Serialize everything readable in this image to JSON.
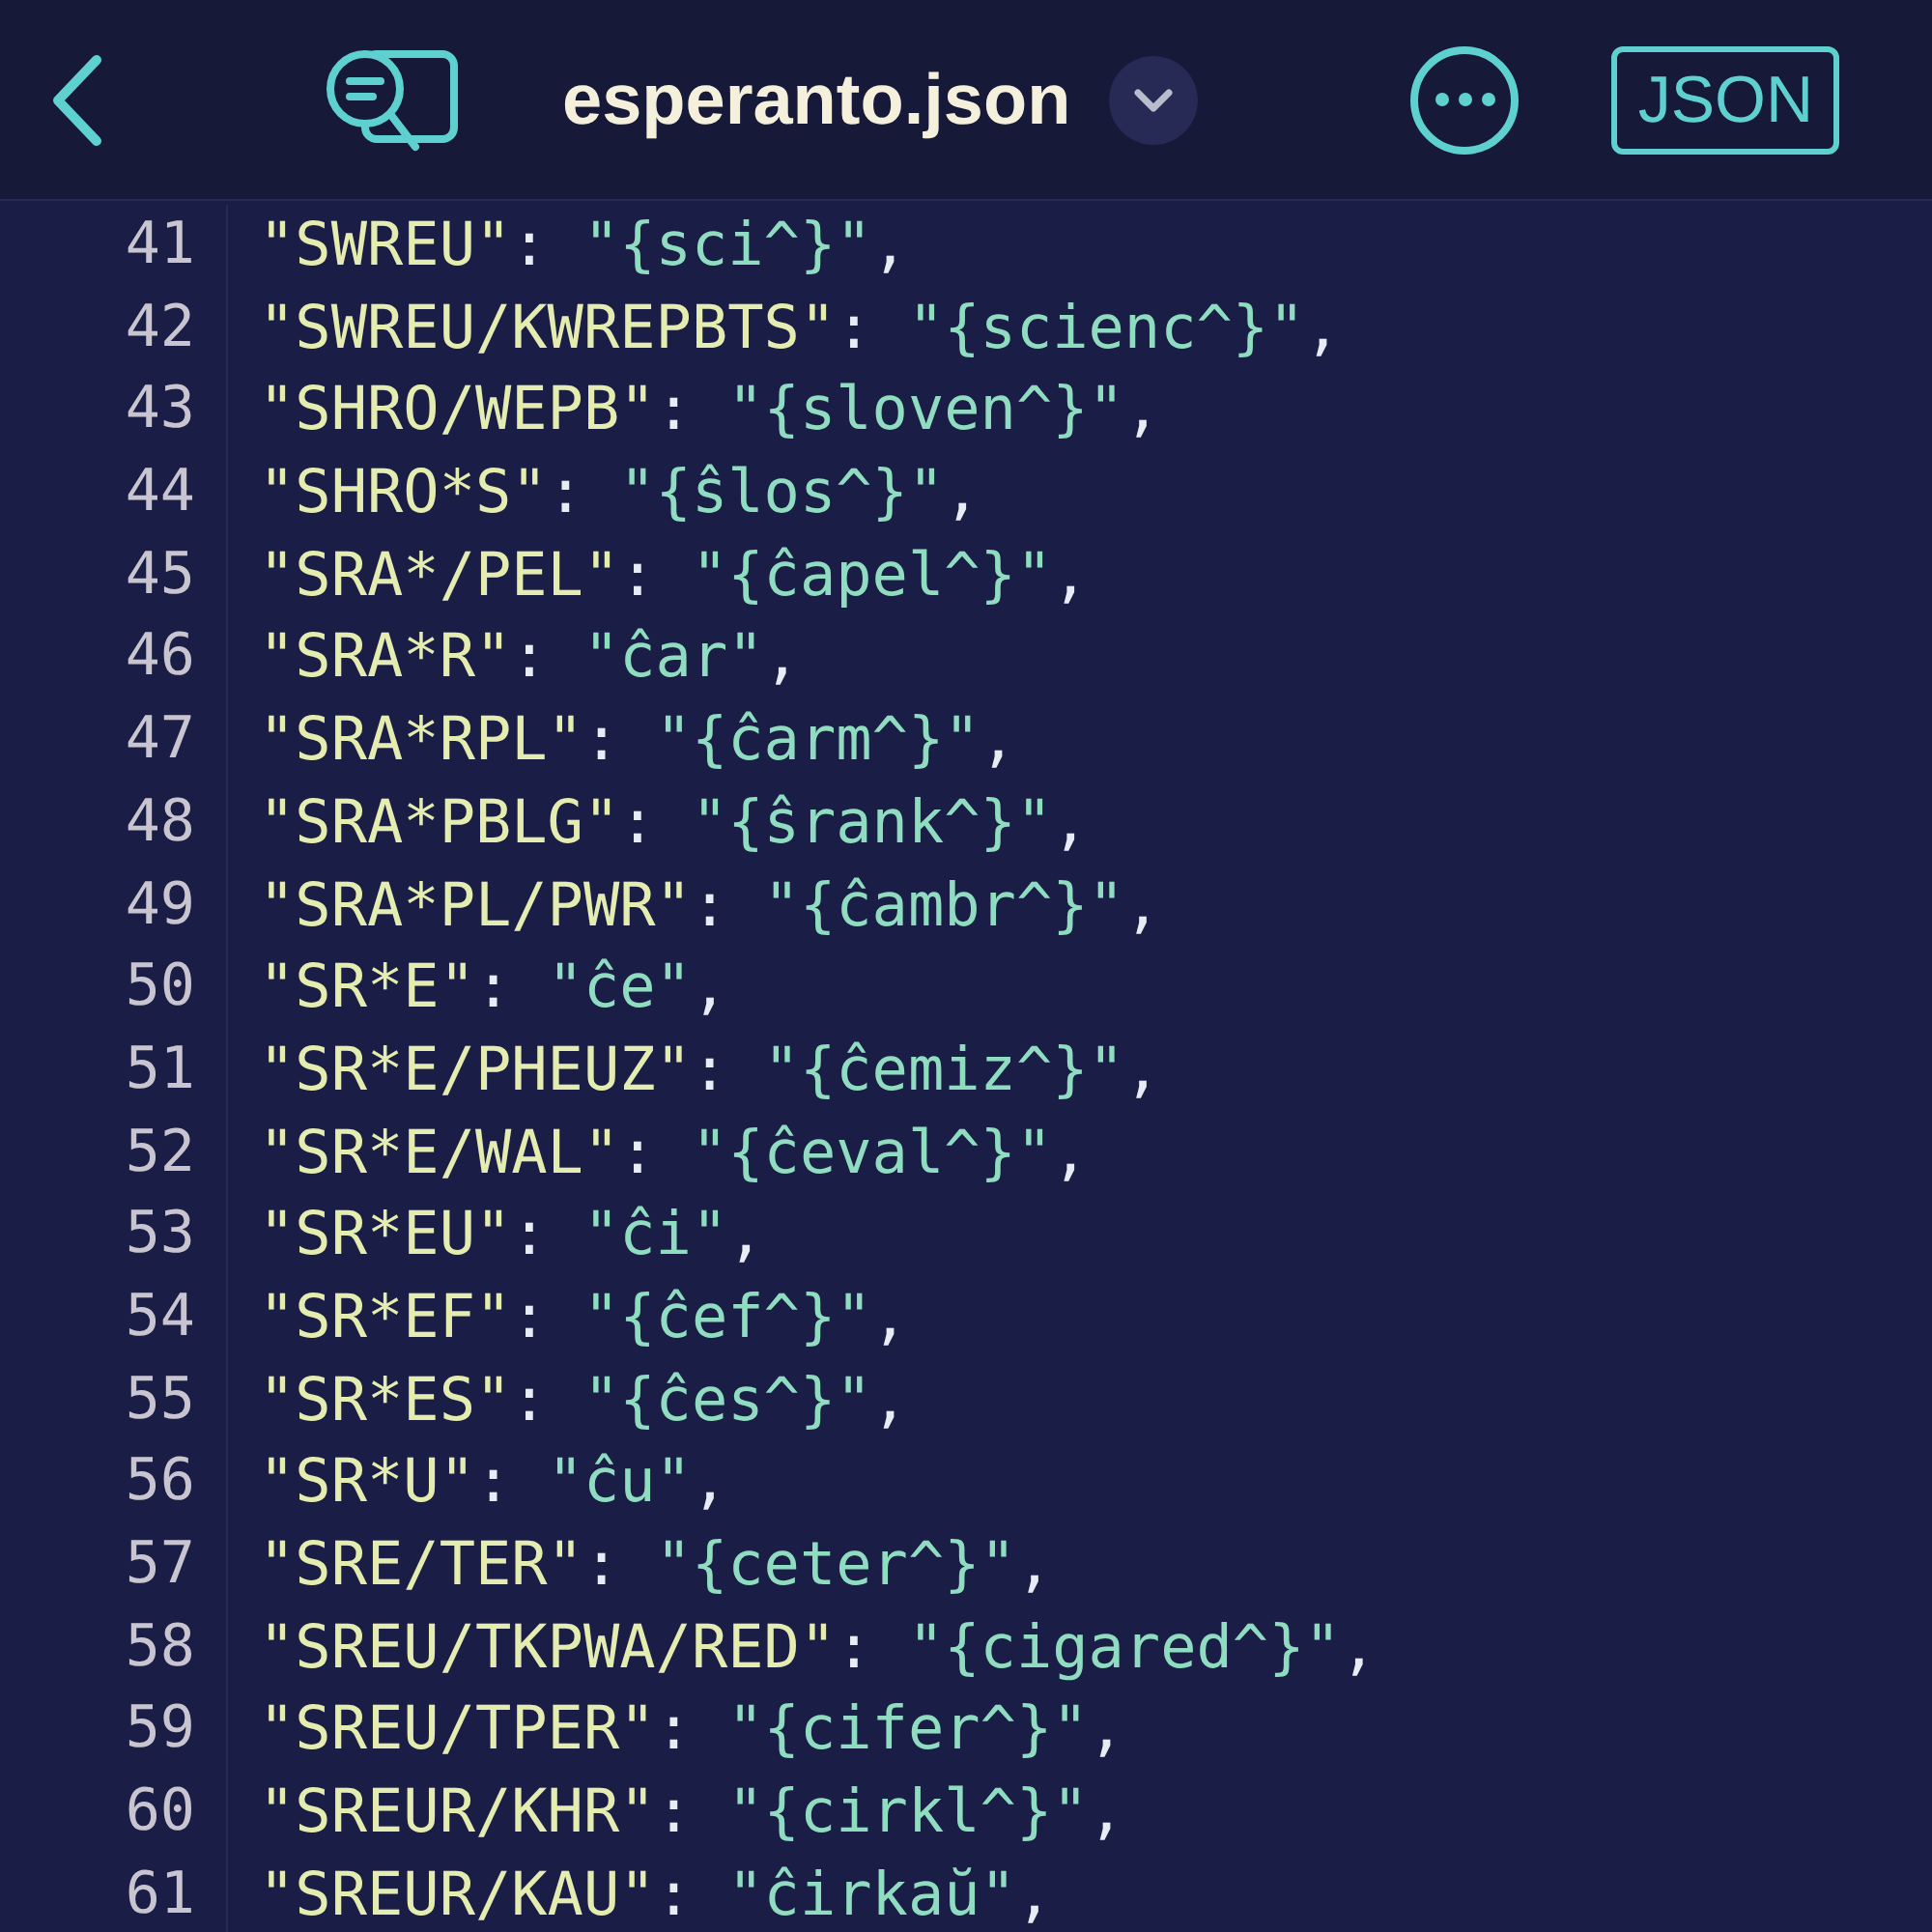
{
  "header": {
    "title": "esperanto.json",
    "badge": "JSON"
  },
  "lines": [
    {
      "number": "41",
      "segments": [
        {
          "kind": "key",
          "text": "\"SWREU\""
        },
        {
          "kind": "punct",
          "text": ": "
        },
        {
          "kind": "string",
          "text": "\"{sci^}\""
        },
        {
          "kind": "punct",
          "text": ","
        }
      ]
    },
    {
      "number": "42",
      "segments": [
        {
          "kind": "key",
          "text": "\"SWREU/KWREPBTS\""
        },
        {
          "kind": "punct",
          "text": ": "
        },
        {
          "kind": "string",
          "text": "\"{scienc^}\""
        },
        {
          "kind": "punct",
          "text": ","
        }
      ]
    },
    {
      "number": "43",
      "segments": [
        {
          "kind": "key",
          "text": "\"SHRO/WEPB\""
        },
        {
          "kind": "punct",
          "text": ": "
        },
        {
          "kind": "string",
          "text": "\"{sloven^}\""
        },
        {
          "kind": "punct",
          "text": ","
        }
      ]
    },
    {
      "number": "44",
      "segments": [
        {
          "kind": "key",
          "text": "\"SHRO*S\""
        },
        {
          "kind": "punct",
          "text": ": "
        },
        {
          "kind": "string",
          "text": "\"{ŝlos^}\""
        },
        {
          "kind": "punct",
          "text": ","
        }
      ]
    },
    {
      "number": "45",
      "segments": [
        {
          "kind": "key",
          "text": "\"SRA*/PEL\""
        },
        {
          "kind": "punct",
          "text": ": "
        },
        {
          "kind": "string",
          "text": "\"{ĉapel^}\""
        },
        {
          "kind": "punct",
          "text": ","
        }
      ]
    },
    {
      "number": "46",
      "segments": [
        {
          "kind": "key",
          "text": "\"SRA*R\""
        },
        {
          "kind": "punct",
          "text": ": "
        },
        {
          "kind": "string",
          "text": "\"ĉar\""
        },
        {
          "kind": "punct",
          "text": ","
        }
      ]
    },
    {
      "number": "47",
      "segments": [
        {
          "kind": "key",
          "text": "\"SRA*RPL\""
        },
        {
          "kind": "punct",
          "text": ": "
        },
        {
          "kind": "string",
          "text": "\"{ĉarm^}\""
        },
        {
          "kind": "punct",
          "text": ","
        }
      ]
    },
    {
      "number": "48",
      "segments": [
        {
          "kind": "key",
          "text": "\"SRA*PBLG\""
        },
        {
          "kind": "punct",
          "text": ": "
        },
        {
          "kind": "string",
          "text": "\"{ŝrank^}\""
        },
        {
          "kind": "punct",
          "text": ","
        }
      ]
    },
    {
      "number": "49",
      "segments": [
        {
          "kind": "key",
          "text": "\"SRA*PL/PWR\""
        },
        {
          "kind": "punct",
          "text": ": "
        },
        {
          "kind": "string",
          "text": "\"{ĉambr^}\""
        },
        {
          "kind": "punct",
          "text": ","
        }
      ]
    },
    {
      "number": "50",
      "segments": [
        {
          "kind": "key",
          "text": "\"SR*E\""
        },
        {
          "kind": "punct",
          "text": ": "
        },
        {
          "kind": "string",
          "text": "\"ĉe\""
        },
        {
          "kind": "punct",
          "text": ","
        }
      ]
    },
    {
      "number": "51",
      "segments": [
        {
          "kind": "key",
          "text": "\"SR*E/PHEUZ\""
        },
        {
          "kind": "punct",
          "text": ": "
        },
        {
          "kind": "string",
          "text": "\"{ĉemiz^}\""
        },
        {
          "kind": "punct",
          "text": ","
        }
      ]
    },
    {
      "number": "52",
      "segments": [
        {
          "kind": "key",
          "text": "\"SR*E/WAL\""
        },
        {
          "kind": "punct",
          "text": ": "
        },
        {
          "kind": "string",
          "text": "\"{ĉeval^}\""
        },
        {
          "kind": "punct",
          "text": ","
        }
      ]
    },
    {
      "number": "53",
      "segments": [
        {
          "kind": "key",
          "text": "\"SR*EU\""
        },
        {
          "kind": "punct",
          "text": ": "
        },
        {
          "kind": "string",
          "text": "\"ĉi\""
        },
        {
          "kind": "punct",
          "text": ","
        }
      ]
    },
    {
      "number": "54",
      "segments": [
        {
          "kind": "key",
          "text": "\"SR*EF\""
        },
        {
          "kind": "punct",
          "text": ": "
        },
        {
          "kind": "string",
          "text": "\"{ĉef^}\""
        },
        {
          "kind": "punct",
          "text": ","
        }
      ]
    },
    {
      "number": "55",
      "segments": [
        {
          "kind": "key",
          "text": "\"SR*ES\""
        },
        {
          "kind": "punct",
          "text": ": "
        },
        {
          "kind": "string",
          "text": "\"{ĉes^}\""
        },
        {
          "kind": "punct",
          "text": ","
        }
      ]
    },
    {
      "number": "56",
      "segments": [
        {
          "kind": "key",
          "text": "\"SR*U\""
        },
        {
          "kind": "punct",
          "text": ": "
        },
        {
          "kind": "string",
          "text": "\"ĉu\""
        },
        {
          "kind": "punct",
          "text": ","
        }
      ]
    },
    {
      "number": "57",
      "segments": [
        {
          "kind": "key",
          "text": "\"SRE/TER\""
        },
        {
          "kind": "punct",
          "text": ": "
        },
        {
          "kind": "string",
          "text": "\"{ceter^}\""
        },
        {
          "kind": "punct",
          "text": ","
        }
      ]
    },
    {
      "number": "58",
      "segments": [
        {
          "kind": "key",
          "text": "\"SREU/TKPWA/RED\""
        },
        {
          "kind": "punct",
          "text": ": "
        },
        {
          "kind": "string",
          "text": "\"{cigared^}\""
        },
        {
          "kind": "punct",
          "text": ","
        }
      ]
    },
    {
      "number": "59",
      "segments": [
        {
          "kind": "key",
          "text": "\"SREU/TPER\""
        },
        {
          "kind": "punct",
          "text": ": "
        },
        {
          "kind": "string",
          "text": "\"{cifer^}\""
        },
        {
          "kind": "punct",
          "text": ","
        }
      ]
    },
    {
      "number": "60",
      "segments": [
        {
          "kind": "key",
          "text": "\"SREUR/KHR\""
        },
        {
          "kind": "punct",
          "text": ": "
        },
        {
          "kind": "string",
          "text": "\"{cirkl^}\""
        },
        {
          "kind": "punct",
          "text": ","
        }
      ]
    },
    {
      "number": "61",
      "segments": [
        {
          "kind": "key",
          "text": "\"SREUR/KAU\""
        },
        {
          "kind": "punct",
          "text": ": "
        },
        {
          "kind": "string",
          "text": "\"ĉirkaŭ\""
        },
        {
          "kind": "punct",
          "text": ","
        }
      ]
    }
  ]
}
